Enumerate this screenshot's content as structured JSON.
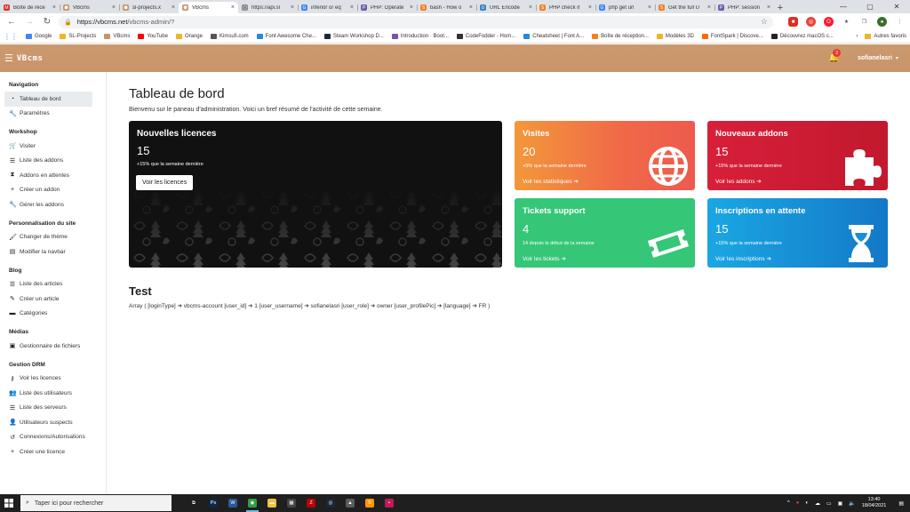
{
  "browser": {
    "tabs": [
      {
        "label": "Boîte de réce",
        "color": "#d93025",
        "glyph": "M"
      },
      {
        "label": "VBcms",
        "color": "#c8946a",
        "glyph": "⬢"
      },
      {
        "label": "sl-projects.x",
        "color": "#c8946a",
        "glyph": "⬢"
      },
      {
        "label": "VBcms",
        "color": "#c8946a",
        "glyph": "⬢",
        "active": true
      },
      {
        "label": "https://api.sl",
        "color": "#888888",
        "glyph": "▢"
      },
      {
        "label": "inferior or eq",
        "color": "#4285f4",
        "glyph": "G"
      },
      {
        "label": "PHP: Opérate",
        "color": "#6a5fa8",
        "glyph": "P"
      },
      {
        "label": "bash - How o",
        "color": "#f48024",
        "glyph": "S"
      },
      {
        "label": "URL Encode",
        "color": "#3b82c4",
        "glyph": "U"
      },
      {
        "label": "PHP check if",
        "color": "#f48024",
        "glyph": "S"
      },
      {
        "label": "php get url",
        "color": "#4285f4",
        "glyph": "G"
      },
      {
        "label": "Get the full U",
        "color": "#f48024",
        "glyph": "S"
      },
      {
        "label": "PHP: session",
        "color": "#6a5fa8",
        "glyph": "P"
      }
    ],
    "url_host": "https://vbcms.net",
    "url_path": "/vbcms-admin/?",
    "bookmarks": [
      {
        "label": "Google",
        "color": "#4285f4"
      },
      {
        "label": "SL-Projects",
        "color": "#f0b429"
      },
      {
        "label": "VBcms",
        "color": "#c8946a"
      },
      {
        "label": "YouTube",
        "color": "#ff0000"
      },
      {
        "label": "Orange",
        "color": "#f0b429"
      },
      {
        "label": "Kimsufi.com",
        "color": "#555555"
      },
      {
        "label": "Font Awesome Che...",
        "color": "#228ae6"
      },
      {
        "label": "Steam Workshop D...",
        "color": "#1b2838"
      },
      {
        "label": "Introduction · Boot...",
        "color": "#7952b3"
      },
      {
        "label": "CodeFodder - Hom...",
        "color": "#333333"
      },
      {
        "label": "Cheatsheet | Font A...",
        "color": "#228ae6"
      },
      {
        "label": "Boîte de réception...",
        "color": "#f48024"
      },
      {
        "label": "Modèles 3D",
        "color": "#f0b429"
      },
      {
        "label": "FontSpark | Discove...",
        "color": "#ff6a00"
      },
      {
        "label": "Découvrez macOS c...",
        "color": "#222222"
      }
    ],
    "bookmarks_other": "Autres favoris"
  },
  "navbar": {
    "brand": "VBcms",
    "notification_count": "3",
    "username": "sofianelasri"
  },
  "sidebar": {
    "sections": [
      {
        "title": "Navigation",
        "items": [
          {
            "label": "Tableau de bord",
            "icon": "gauge-icon",
            "glyph": "◔",
            "active": true
          },
          {
            "label": "Paramètres",
            "icon": "wrench-icon",
            "glyph": "🔧"
          }
        ]
      },
      {
        "title": "Workshop",
        "items": [
          {
            "label": "Visiter",
            "icon": "shopping-cart-icon",
            "glyph": "🛒"
          },
          {
            "label": "Liste des addons",
            "icon": "list-icon",
            "glyph": "☰"
          },
          {
            "label": "Addons en attentes",
            "icon": "hourglass-icon",
            "glyph": "⧗"
          },
          {
            "label": "Créer un addon",
            "icon": "plus-icon",
            "glyph": "+"
          },
          {
            "label": "Gérer les addons",
            "icon": "wrench-icon",
            "glyph": "🔧"
          }
        ]
      },
      {
        "title": "Personnalisation du site",
        "items": [
          {
            "label": "Changer de thème",
            "icon": "paint-brush-icon",
            "glyph": "🖌"
          },
          {
            "label": "Modifier la navbar",
            "icon": "bars-icon",
            "glyph": "▤"
          }
        ]
      },
      {
        "title": "Blog",
        "items": [
          {
            "label": "Liste des articles",
            "icon": "list-icon",
            "glyph": "☰"
          },
          {
            "label": "Créer un article",
            "icon": "pencil-icon",
            "glyph": "✎"
          },
          {
            "label": "Catégories",
            "icon": "folder-icon",
            "glyph": "▬"
          }
        ]
      },
      {
        "title": "Médias",
        "items": [
          {
            "label": "Gestionnaire de fichiers",
            "icon": "images-icon",
            "glyph": "▣"
          }
        ]
      },
      {
        "title": "Gestion DRM",
        "items": [
          {
            "label": "Voir les licences",
            "icon": "key-icon",
            "glyph": "⚷"
          },
          {
            "label": "Liste des utilisateurs",
            "icon": "users-icon",
            "glyph": "👥"
          },
          {
            "label": "Liste des serveurs",
            "icon": "list-icon",
            "glyph": "☰"
          },
          {
            "label": "Utilisateurs suspects",
            "icon": "user-alert-icon",
            "glyph": "👤"
          },
          {
            "label": "Connexions/Autorisations",
            "icon": "history-icon",
            "glyph": "↺"
          },
          {
            "label": "Créer une licence",
            "icon": "plus-icon",
            "glyph": "+"
          }
        ]
      }
    ]
  },
  "main": {
    "title": "Tableau de bord",
    "subtitle": "Bienvenu sur le paneau d'administration. Voici un bref résumé de l'activité de cette semaine.",
    "cards": {
      "licences": {
        "title": "Nouvelles licences",
        "value": "15",
        "trend": "+15% que la semaine dernière",
        "button": "Voir les licences"
      },
      "visites": {
        "title": "Visites",
        "value": "20",
        "trend": "+5% que la semaine dernière",
        "link": "Voir les statistiques ➔"
      },
      "addons": {
        "title": "Nouveaux addons",
        "value": "15",
        "trend": "+15% que la semaine dernière",
        "link": "Voir les addons ➔"
      },
      "tickets": {
        "title": "Tickets support",
        "value": "4",
        "trend": "14 depuis le début de la semaine",
        "link": "Voir les tickets ➔"
      },
      "inscriptions": {
        "title": "Inscriptions en attente",
        "value": "15",
        "trend": "+15% que la semaine dernière",
        "link": "Voir les inscriptions ➔"
      }
    },
    "test_title": "Test",
    "array_dump": "Array ( [loginType] ➔ vbcms-account [user_id] ➔ 1 [user_username] ➔ sofianelasri [user_role] ➔ owner [user_profilePic] ➔ [language] ➔ FR )"
  },
  "taskbar": {
    "search_placeholder": "Taper ici pour rechercher",
    "apps": [
      {
        "name": "task-view-icon",
        "glyph": "⧉",
        "color": "#1f1f1f"
      },
      {
        "name": "photoshop-icon",
        "glyph": "Ps",
        "color": "#0b2a4a"
      },
      {
        "name": "word-icon",
        "glyph": "W",
        "color": "#2b579a"
      },
      {
        "name": "chrome-icon",
        "glyph": "◉",
        "color": "#2f9e44",
        "open": true
      },
      {
        "name": "file-explorer-icon",
        "glyph": "▬",
        "color": "#f0c040"
      },
      {
        "name": "store-icon",
        "glyph": "▦",
        "color": "#444444"
      },
      {
        "name": "filezilla-icon",
        "glyph": "Z",
        "color": "#bf0000"
      },
      {
        "name": "steam-icon",
        "glyph": "◎",
        "color": "#1b2838"
      },
      {
        "name": "photos-icon",
        "glyph": "▲",
        "color": "#5c5c5c"
      },
      {
        "name": "sublime-icon",
        "glyph": "S",
        "color": "#ff9800"
      },
      {
        "name": "app-red-icon",
        "glyph": "▪",
        "color": "#c2185b"
      }
    ],
    "time": "13:40",
    "date": "18/04/2021"
  },
  "colors": {
    "navbar": "#c8946a",
    "card_visites": "#f06848",
    "card_addons": "#d81f3a",
    "card_tickets": "#35c677",
    "card_inscriptions": "#1a8fd6"
  }
}
